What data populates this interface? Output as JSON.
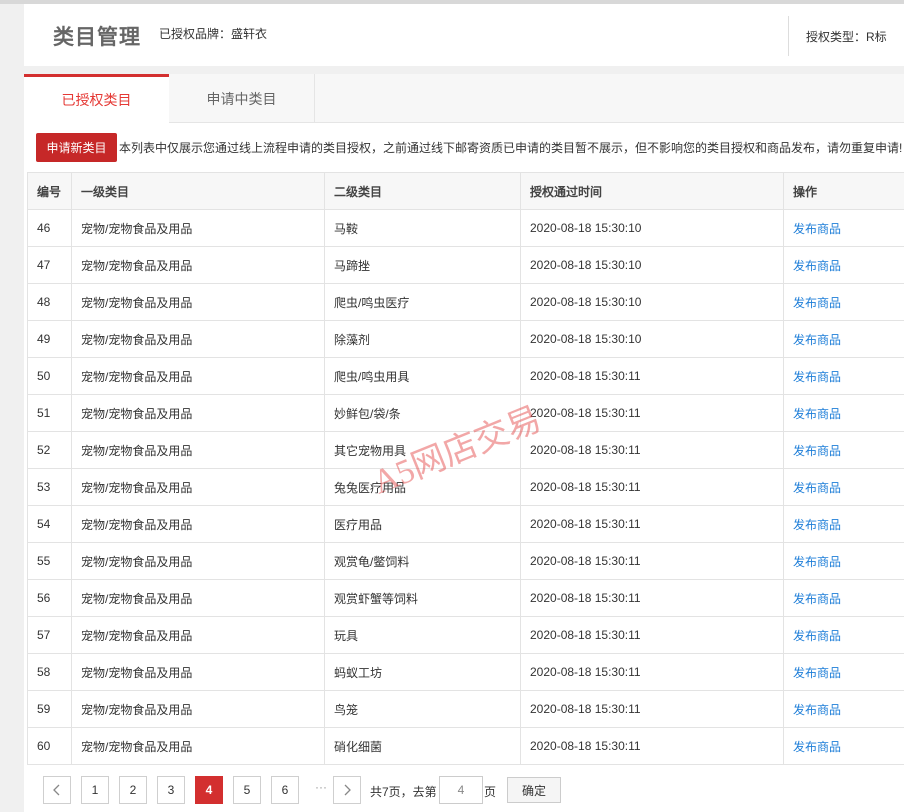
{
  "header": {
    "title": "类目管理",
    "brand": "已授权品牌：盛轩衣",
    "auth_type": "授权类型：R标"
  },
  "tabs": [
    {
      "label": "已授权类目"
    },
    {
      "label": "申请中类目"
    }
  ],
  "toolbar": {
    "apply_label": "申请新类目",
    "notice": "本列表中仅展示您通过线上流程申请的类目授权，之前通过线下邮寄资质已申请的类目暂不展示，但不影响您的类目授权和商品发布，请勿重复申请!"
  },
  "table": {
    "columns": [
      "编号",
      "一级类目",
      "二级类目",
      "授权通过时间",
      "操作"
    ],
    "rows": [
      {
        "id": "46",
        "cat1": "宠物/宠物食品及用品",
        "cat2": "马鞍",
        "time": "2020-08-18 15:30:10",
        "action": "发布商品"
      },
      {
        "id": "47",
        "cat1": "宠物/宠物食品及用品",
        "cat2": "马蹄挫",
        "time": "2020-08-18 15:30:10",
        "action": "发布商品"
      },
      {
        "id": "48",
        "cat1": "宠物/宠物食品及用品",
        "cat2": "爬虫/鸣虫医疗",
        "time": "2020-08-18 15:30:10",
        "action": "发布商品"
      },
      {
        "id": "49",
        "cat1": "宠物/宠物食品及用品",
        "cat2": "除藻剂",
        "time": "2020-08-18 15:30:10",
        "action": "发布商品"
      },
      {
        "id": "50",
        "cat1": "宠物/宠物食品及用品",
        "cat2": "爬虫/鸣虫用具",
        "time": "2020-08-18 15:30:11",
        "action": "发布商品"
      },
      {
        "id": "51",
        "cat1": "宠物/宠物食品及用品",
        "cat2": "妙鲜包/袋/条",
        "time": "2020-08-18 15:30:11",
        "action": "发布商品"
      },
      {
        "id": "52",
        "cat1": "宠物/宠物食品及用品",
        "cat2": "其它宠物用具",
        "time": "2020-08-18 15:30:11",
        "action": "发布商品"
      },
      {
        "id": "53",
        "cat1": "宠物/宠物食品及用品",
        "cat2": "兔兔医疗用品",
        "time": "2020-08-18 15:30:11",
        "action": "发布商品"
      },
      {
        "id": "54",
        "cat1": "宠物/宠物食品及用品",
        "cat2": "医疗用品",
        "time": "2020-08-18 15:30:11",
        "action": "发布商品"
      },
      {
        "id": "55",
        "cat1": "宠物/宠物食品及用品",
        "cat2": "观赏龟/鳖饲料",
        "time": "2020-08-18 15:30:11",
        "action": "发布商品"
      },
      {
        "id": "56",
        "cat1": "宠物/宠物食品及用品",
        "cat2": "观赏虾蟹等饲料",
        "time": "2020-08-18 15:30:11",
        "action": "发布商品"
      },
      {
        "id": "57",
        "cat1": "宠物/宠物食品及用品",
        "cat2": "玩具",
        "time": "2020-08-18 15:30:11",
        "action": "发布商品"
      },
      {
        "id": "58",
        "cat1": "宠物/宠物食品及用品",
        "cat2": "蚂蚁工坊",
        "time": "2020-08-18 15:30:11",
        "action": "发布商品"
      },
      {
        "id": "59",
        "cat1": "宠物/宠物食品及用品",
        "cat2": "鸟笼",
        "time": "2020-08-18 15:30:11",
        "action": "发布商品"
      },
      {
        "id": "60",
        "cat1": "宠物/宠物食品及用品",
        "cat2": "硝化细菌",
        "time": "2020-08-18 15:30:11",
        "action": "发布商品"
      }
    ]
  },
  "pagination": {
    "pages": [
      "1",
      "2",
      "3",
      "4",
      "5",
      "6"
    ],
    "current_page": "4",
    "ellipsis": "···",
    "total": "共7页，去第",
    "goto_value": "4",
    "page_unit": "页",
    "confirm_label": "确定"
  },
  "watermark": "A5网店交易",
  "colors": {
    "accent_red": "#d32f2f",
    "link_blue": "#1e7ed8"
  },
  "icons": {
    "prev": "chevron-left-icon",
    "next": "chevron-right-icon"
  }
}
